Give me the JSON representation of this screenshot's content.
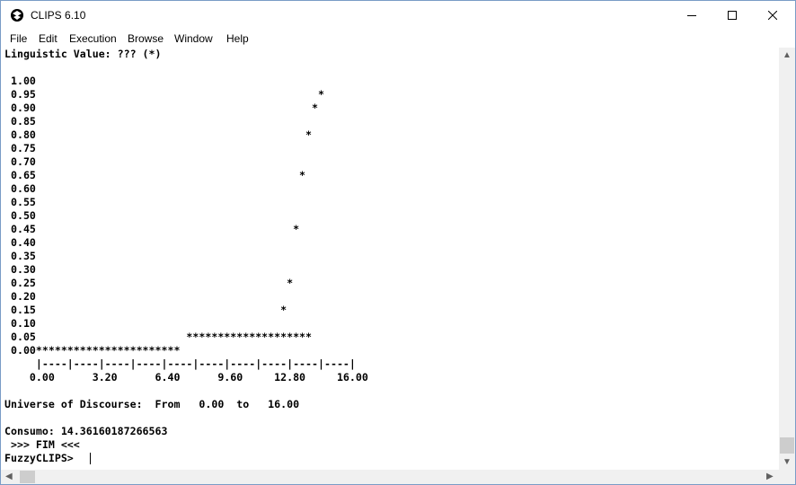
{
  "window": {
    "title": "CLIPS 6.10"
  },
  "menu": [
    "File",
    "Edit",
    "Execution",
    "Browse",
    "Window",
    "Help"
  ],
  "terminal": {
    "lines": [
      "Linguistic Value: ??? (*)",
      "",
      " 1.00",
      " 0.95                                             *",
      " 0.90                                            *",
      " 0.85",
      " 0.80                                           *",
      " 0.75",
      " 0.70",
      " 0.65                                          *",
      " 0.60",
      " 0.55",
      " 0.50",
      " 0.45                                         *",
      " 0.40",
      " 0.35",
      " 0.30",
      " 0.25                                        *",
      " 0.20",
      " 0.15                                       *",
      " 0.10",
      " 0.05                        ********************",
      " 0.00***********************",
      "     |----|----|----|----|----|----|----|----|----|----|",
      "    0.00      3.20      6.40      9.60     12.80     16.00",
      "",
      "Universe of Discourse:  From   0.00  to   16.00",
      "",
      "Consumo: 14.36160187266563",
      " >>> FIM <<<",
      "FuzzyCLIPS> "
    ]
  }
}
